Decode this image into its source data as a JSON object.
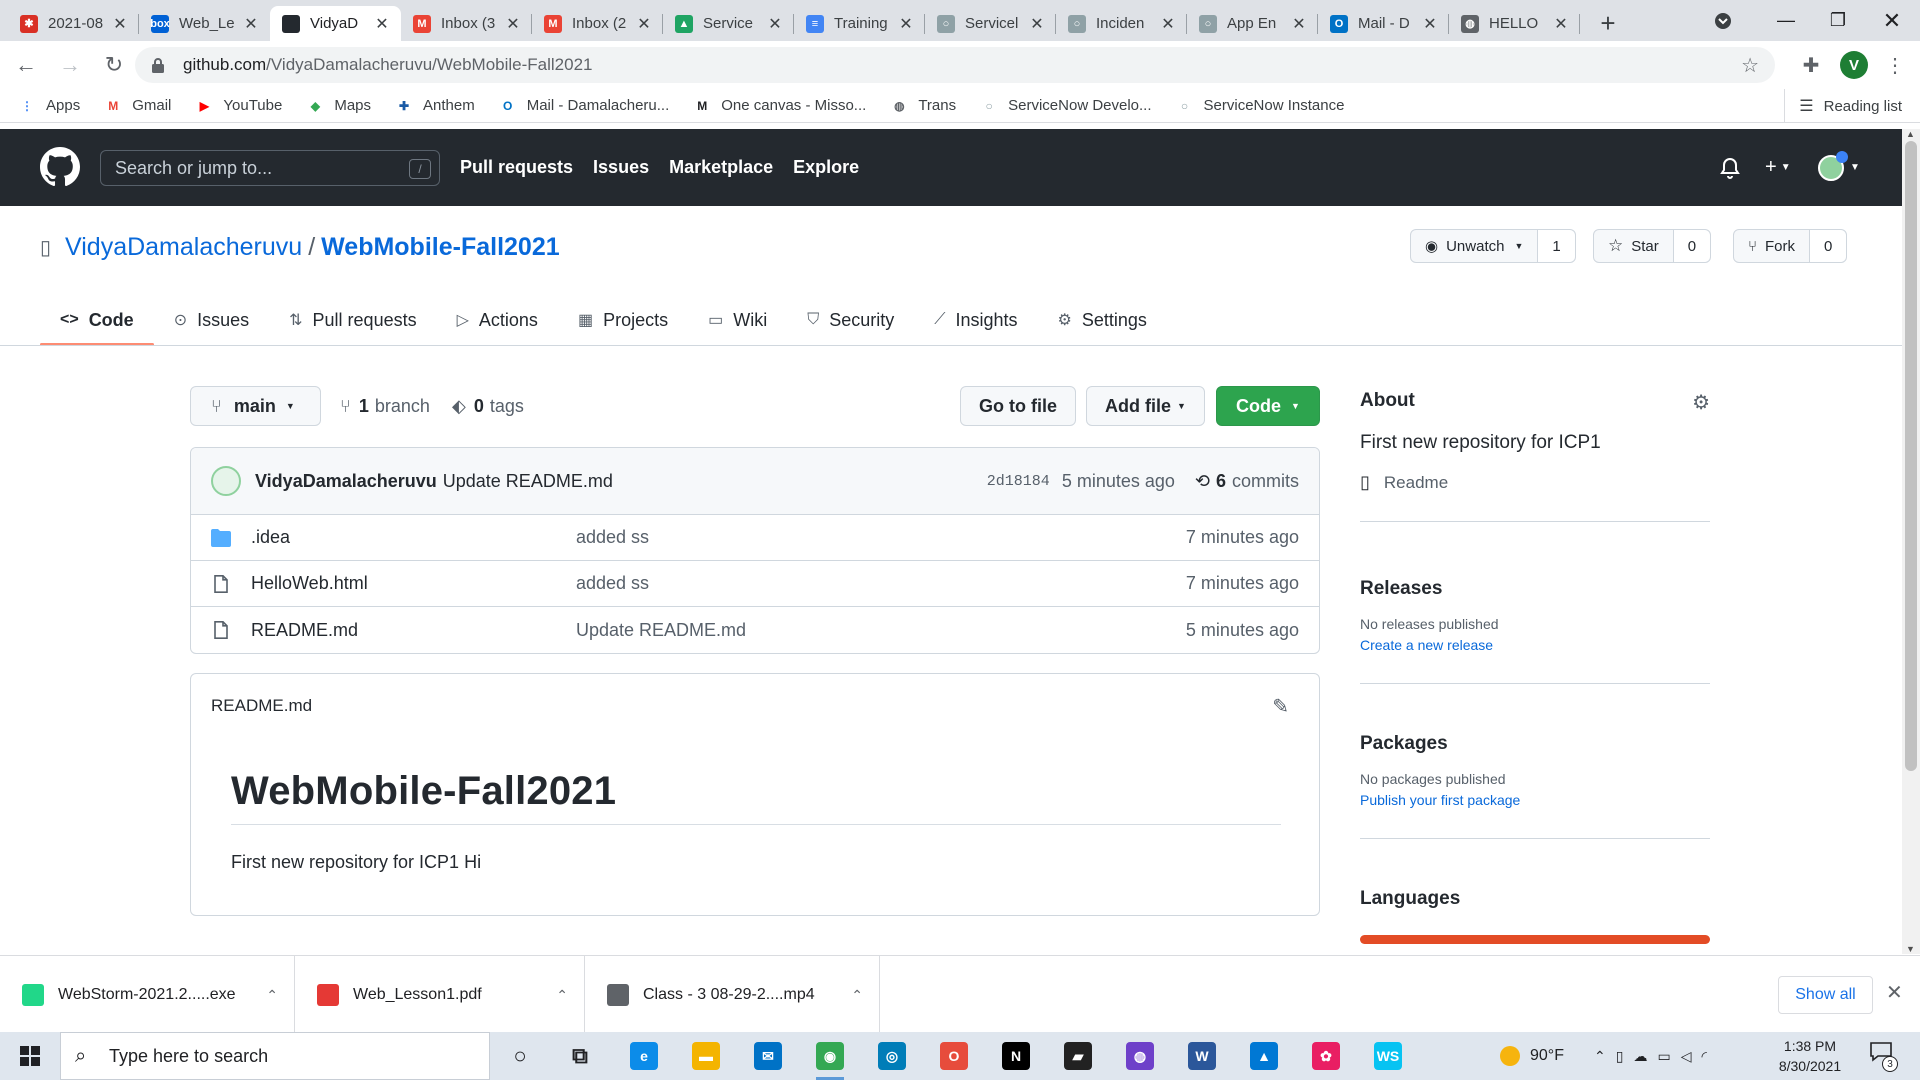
{
  "browser": {
    "tabs": [
      {
        "title": "2021-08",
        "color": "#d93025",
        "glyph": "✱"
      },
      {
        "title": "Web_Le",
        "color": "#0061d5",
        "glyph": "box"
      },
      {
        "title": "VidyaD",
        "color": "#24292f",
        "glyph": ""
      },
      {
        "title": "Inbox (3",
        "color": "#ea4335",
        "glyph": "M"
      },
      {
        "title": "Inbox (2",
        "color": "#ea4335",
        "glyph": "M"
      },
      {
        "title": "Service",
        "color": "#1fa463",
        "glyph": "▲"
      },
      {
        "title": "Training",
        "color": "#4285f4",
        "glyph": "≡"
      },
      {
        "title": "Servicel",
        "color": "#8fa1a6",
        "glyph": "○"
      },
      {
        "title": "Inciden",
        "color": "#8fa1a6",
        "glyph": "○"
      },
      {
        "title": "App En",
        "color": "#8fa1a6",
        "glyph": "○"
      },
      {
        "title": "Mail - D",
        "color": "#0072c6",
        "glyph": "O"
      },
      {
        "title": "HELLO",
        "color": "#5f6368",
        "glyph": "◍"
      }
    ],
    "url_host": "github.com",
    "url_path": "/VidyaDamalacheruvu/WebMobile-Fall2021",
    "profile_initial": "V",
    "bookmarks": [
      {
        "label": "Apps",
        "color": "#4285f4",
        "glyph": "⋮"
      },
      {
        "label": "Gmail",
        "color": "#ea4335",
        "glyph": "M"
      },
      {
        "label": "YouTube",
        "color": "#ff0000",
        "glyph": "▶"
      },
      {
        "label": "Maps",
        "color": "#34a853",
        "glyph": "◆"
      },
      {
        "label": "Anthem",
        "color": "#1a5ba6",
        "glyph": "✚"
      },
      {
        "label": "Mail - Damalacheru...",
        "color": "#0072c6",
        "glyph": "O"
      },
      {
        "label": "One canvas - Misso...",
        "color": "#202124",
        "glyph": "M"
      },
      {
        "label": "Trans",
        "color": "#5f6368",
        "glyph": "◍"
      },
      {
        "label": "ServiceNow Develo...",
        "color": "#8fa1a6",
        "glyph": "○"
      },
      {
        "label": "ServiceNow Instance",
        "color": "#8fa1a6",
        "glyph": "○"
      }
    ],
    "reading_list": "Reading list"
  },
  "github": {
    "search_placeholder": "Search or jump to...",
    "search_key": "/",
    "nav": [
      "Pull requests",
      "Issues",
      "Marketplace",
      "Explore"
    ],
    "owner": "VidyaDamalacheruvu",
    "repo": "WebMobile-Fall2021",
    "watch_label": "Unwatch",
    "watch_count": "1",
    "star_label": "Star",
    "star_count": "0",
    "fork_label": "Fork",
    "fork_count": "0",
    "tabs": [
      {
        "label": "Code",
        "icon": "<>"
      },
      {
        "label": "Issues",
        "icon": "⊙"
      },
      {
        "label": "Pull requests",
        "icon": "⇅"
      },
      {
        "label": "Actions",
        "icon": "▷"
      },
      {
        "label": "Projects",
        "icon": "▦"
      },
      {
        "label": "Wiki",
        "icon": "▭"
      },
      {
        "label": "Security",
        "icon": "⛉"
      },
      {
        "label": "Insights",
        "icon": "⟋"
      },
      {
        "label": "Settings",
        "icon": "⚙"
      }
    ],
    "branch": "main",
    "branch_count": "1",
    "branch_word": "branch",
    "tag_count": "0",
    "tag_word": "tags",
    "go_to_file": "Go to file",
    "add_file": "Add file",
    "code_btn": "Code",
    "commit": {
      "author": "VidyaDamalacheruvu",
      "message": "Update README.md",
      "sha": "2d18184",
      "time": "5 minutes ago",
      "count": "6",
      "count_word": "commits"
    },
    "files": [
      {
        "name": ".idea",
        "type": "folder",
        "message": "added ss",
        "time": "7 minutes ago"
      },
      {
        "name": "HelloWeb.html",
        "type": "file",
        "message": "added ss",
        "time": "7 minutes ago"
      },
      {
        "name": "README.md",
        "type": "file",
        "message": "Update README.md",
        "time": "5 minutes ago"
      }
    ],
    "readme": {
      "filename": "README.md",
      "heading": "WebMobile-Fall2021",
      "body": "First new repository for ICP1 Hi"
    },
    "about": {
      "title": "About",
      "description": "First new repository for ICP1",
      "readme_link": "Readme"
    },
    "releases": {
      "title": "Releases",
      "status": "No releases published",
      "link": "Create a new release"
    },
    "packages": {
      "title": "Packages",
      "status": "No packages published",
      "link": "Publish your first package"
    },
    "languages": {
      "title": "Languages",
      "bar_color": "#e34c26"
    }
  },
  "downloads": {
    "items": [
      {
        "name": "WebStorm-2021.2.....exe",
        "color": "#21d789"
      },
      {
        "name": "Web_Lesson1.pdf",
        "color": "#e53935"
      },
      {
        "name": "Class - 3 08-29-2....mp4",
        "color": "#5f6368"
      }
    ],
    "show_all": "Show all"
  },
  "taskbar": {
    "search_placeholder": "Type here to search",
    "apps": [
      {
        "name": "cortana",
        "color": "#202124",
        "glyph": "○"
      },
      {
        "name": "task-view",
        "color": "#202124",
        "glyph": "⧉"
      },
      {
        "name": "edge",
        "color": "#0c8ce9",
        "glyph": "e"
      },
      {
        "name": "file-explorer",
        "color": "#f4b400",
        "glyph": "▬"
      },
      {
        "name": "mail",
        "color": "#0072c6",
        "glyph": "✉"
      },
      {
        "name": "chrome",
        "color": "#34a853",
        "glyph": "◉"
      },
      {
        "name": "dell",
        "color": "#007db8",
        "glyph": "◎"
      },
      {
        "name": "office",
        "color": "#e74c3c",
        "glyph": "O"
      },
      {
        "name": "netflix",
        "color": "#000000",
        "glyph": "N"
      },
      {
        "name": "sticky-notes",
        "color": "#222222",
        "glyph": "▰"
      },
      {
        "name": "github-desktop",
        "color": "#6e40c9",
        "glyph": "◍"
      },
      {
        "name": "word",
        "color": "#2b579a",
        "glyph": "W"
      },
      {
        "name": "photos",
        "color": "#0078d4",
        "glyph": "▲"
      },
      {
        "name": "paint",
        "color": "#e91e63",
        "glyph": "✿"
      },
      {
        "name": "webstorm",
        "color": "#07c3f2",
        "glyph": "WS"
      }
    ],
    "weather": "90°F",
    "time": "1:38 PM",
    "date": "8/30/2021",
    "notification_count": "3"
  }
}
